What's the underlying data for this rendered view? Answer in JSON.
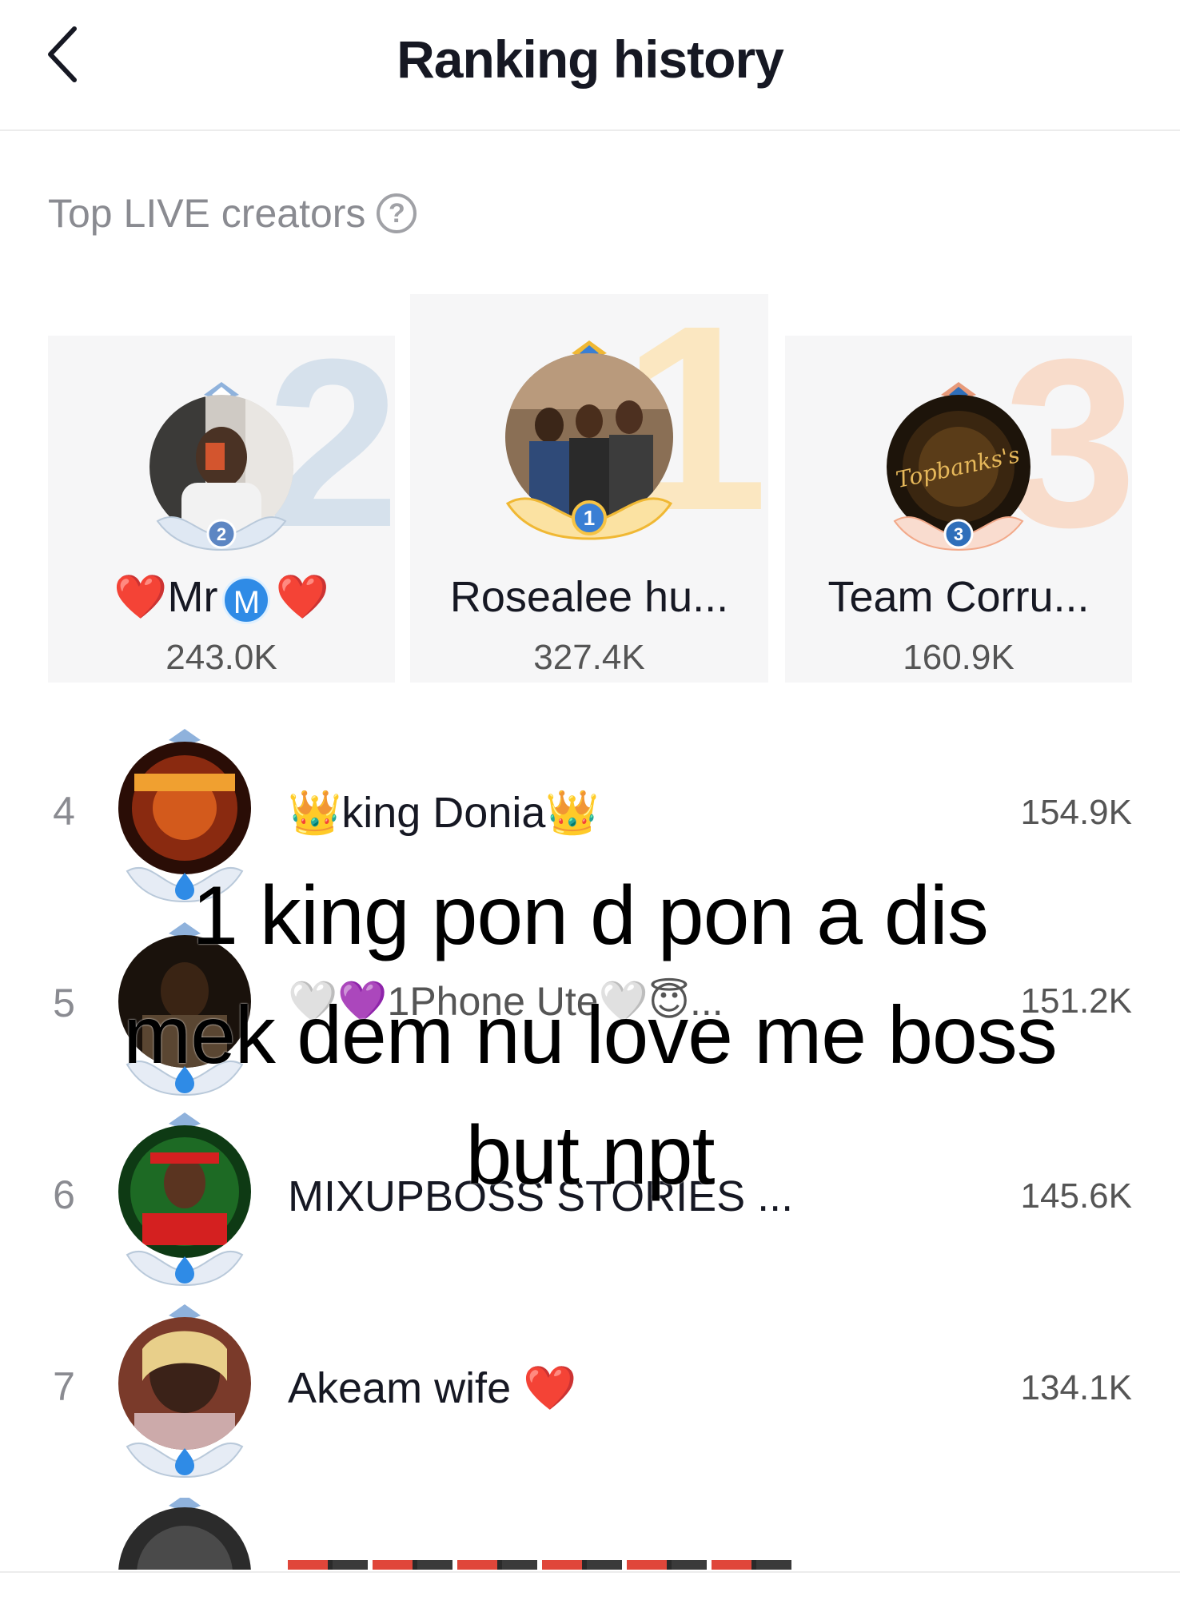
{
  "header": {
    "title": "Ranking history",
    "back_icon": "chevron-left-icon"
  },
  "section": {
    "title": "Top LIVE creators",
    "help_icon": "question-circle-icon"
  },
  "podium": [
    {
      "rank": "2",
      "name_prefix": "❤️Mr",
      "name_badge": "M",
      "name_suffix": "❤️",
      "score": "243.0K",
      "big_digit": "2"
    },
    {
      "rank": "1",
      "name": "Rosealee hu...",
      "score": "327.4K",
      "big_digit": "1"
    },
    {
      "rank": "3",
      "name": "Team Corru...",
      "score": "160.9K",
      "big_digit": "3",
      "avatar_text": "Topbanks's"
    }
  ],
  "list": [
    {
      "rank": "4",
      "name": "👑king Donia👑",
      "score": "154.9K"
    },
    {
      "rank": "5",
      "name": "🤍💜1Phone Ute🤍😇...",
      "score": "151.2K"
    },
    {
      "rank": "6",
      "name": "MIXUPBOSS STORIES ...",
      "score": "145.6K"
    },
    {
      "rank": "7",
      "name": "Akeam wife ❤️",
      "score": "134.1K"
    }
  ],
  "caption": {
    "line1": "1 king pon d pon a dis",
    "line2": "mek dem nu love me boss",
    "line3": "but npt"
  },
  "colors": {
    "gold": "#f6c343",
    "silver": "#b9c9da",
    "bronze": "#f2a98a",
    "accent_blue": "#2f8be6"
  }
}
